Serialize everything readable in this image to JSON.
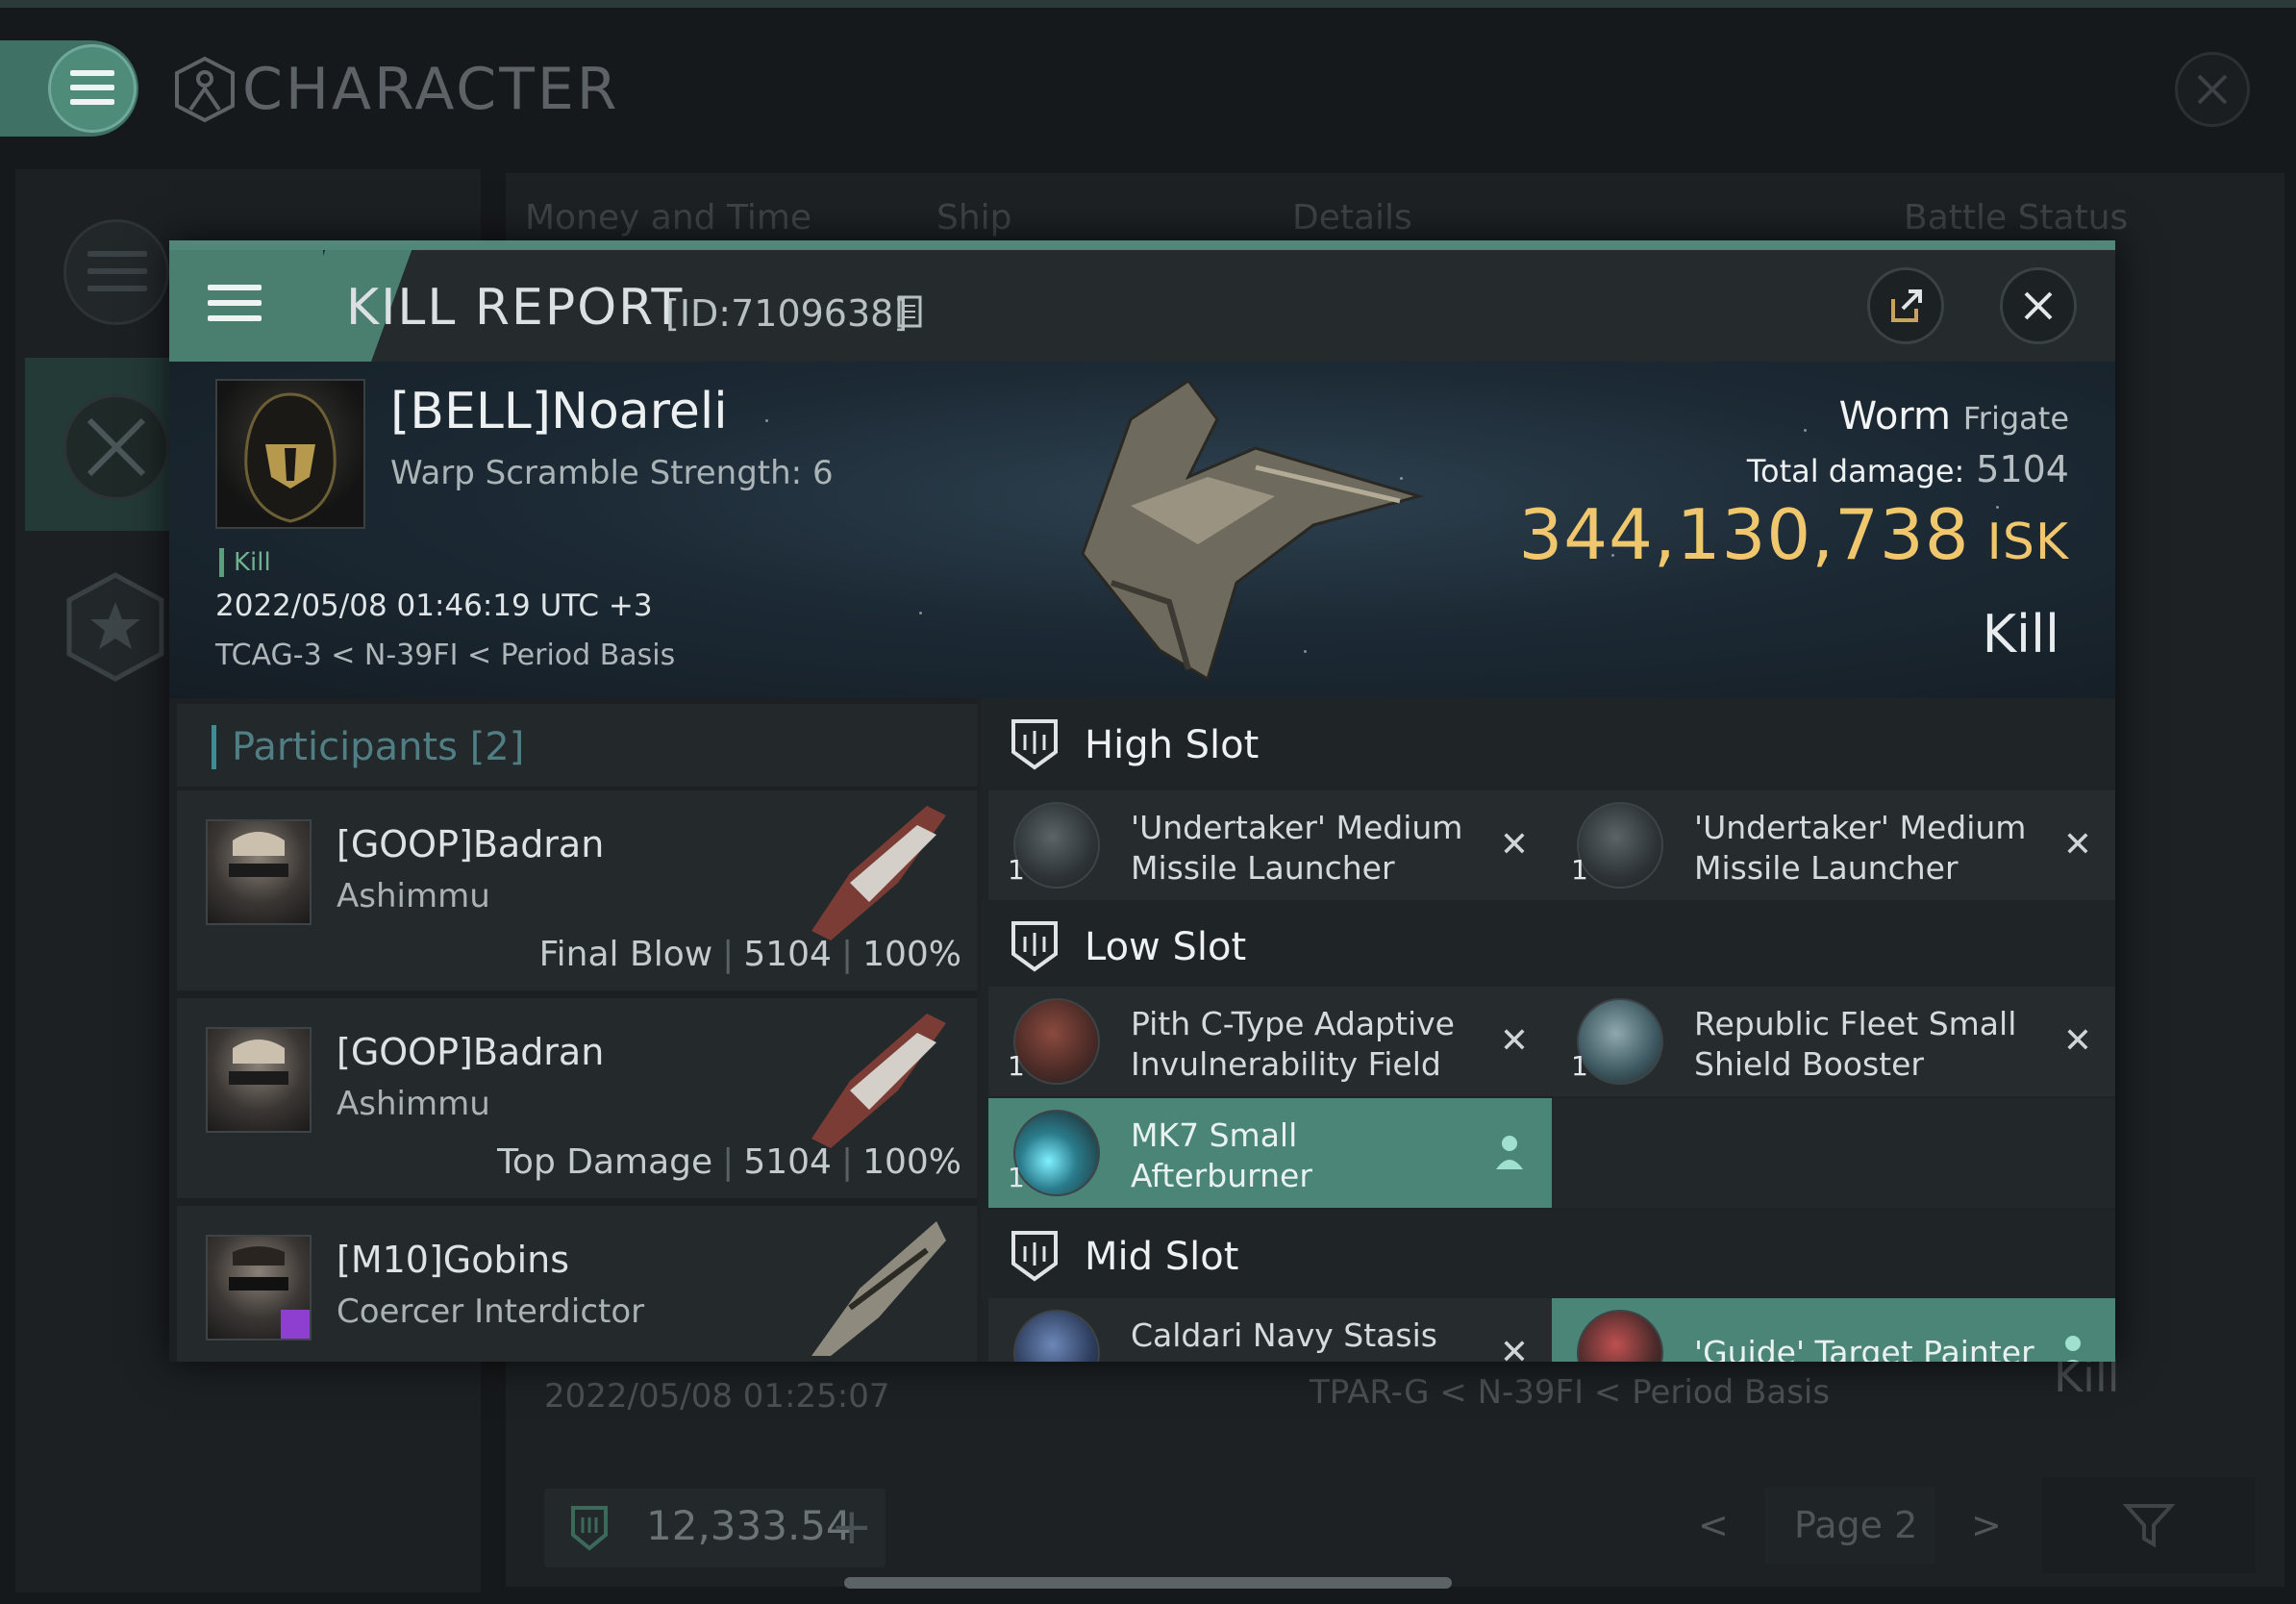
{
  "window": {
    "title": "CHARACTER"
  },
  "background_list": {
    "columns": [
      "Money and Time",
      "Ship",
      "Details",
      "Battle Status"
    ],
    "row_date": "2022/05/08  01:25:07",
    "row_location": "TPAR-G < N-39FI < Period Basis",
    "row_status": "Kill",
    "wallet_value": "12,333.54",
    "page_label": "Page 2"
  },
  "kill_report": {
    "title": "KILL REPORT",
    "id_label": "[ID:7109638]",
    "victim": {
      "name": "[BELL]Noareli",
      "subtitle": "Warp Scramble Strength: 6",
      "kill_tag": "Kill",
      "datetime": "2022/05/08 01:46:19 UTC +3",
      "location": "TCAG-3 < N-39FI < Period Basis",
      "ship_name": "Worm",
      "ship_class": "Frigate",
      "total_damage_label": "Total damage:",
      "total_damage": "5104",
      "isk_value": "344,130,738",
      "isk_unit": "ISK",
      "status": "Kill"
    },
    "participants": {
      "label": "Participants",
      "count": "[2]",
      "rows": [
        {
          "name": "[GOOP]Badran",
          "ship": "Ashimmu",
          "role": "Final Blow",
          "damage": "5104",
          "percent": "100%"
        },
        {
          "name": "[GOOP]Badran",
          "ship": "Ashimmu",
          "role": "Top Damage",
          "damage": "5104",
          "percent": "100%"
        },
        {
          "name": "[M10]Gobins",
          "ship": "Coercer Interdictor"
        }
      ]
    },
    "fitting": {
      "high_slot_label": "High Slot",
      "low_slot_label": "Low Slot",
      "mid_slot_label": "Mid Slot",
      "high": [
        {
          "qty": "1",
          "name": "'Undertaker' Medium Missile Launcher",
          "state": "destroyed"
        },
        {
          "qty": "1",
          "name": "'Undertaker' Medium Missile Launcher",
          "state": "destroyed"
        }
      ],
      "low": [
        {
          "qty": "1",
          "name": "Pith C-Type Adaptive Invulnerability Field",
          "state": "destroyed"
        },
        {
          "qty": "1",
          "name": "Republic Fleet Small Shield Booster",
          "state": "destroyed"
        },
        {
          "qty": "1",
          "name": "MK7 Small Afterburner",
          "state": "dropped"
        }
      ],
      "mid": [
        {
          "name": "Caldari Navy Stasis",
          "state": "destroyed"
        },
        {
          "name": "'Guide' Target Painter",
          "state": "dropped"
        }
      ]
    }
  }
}
